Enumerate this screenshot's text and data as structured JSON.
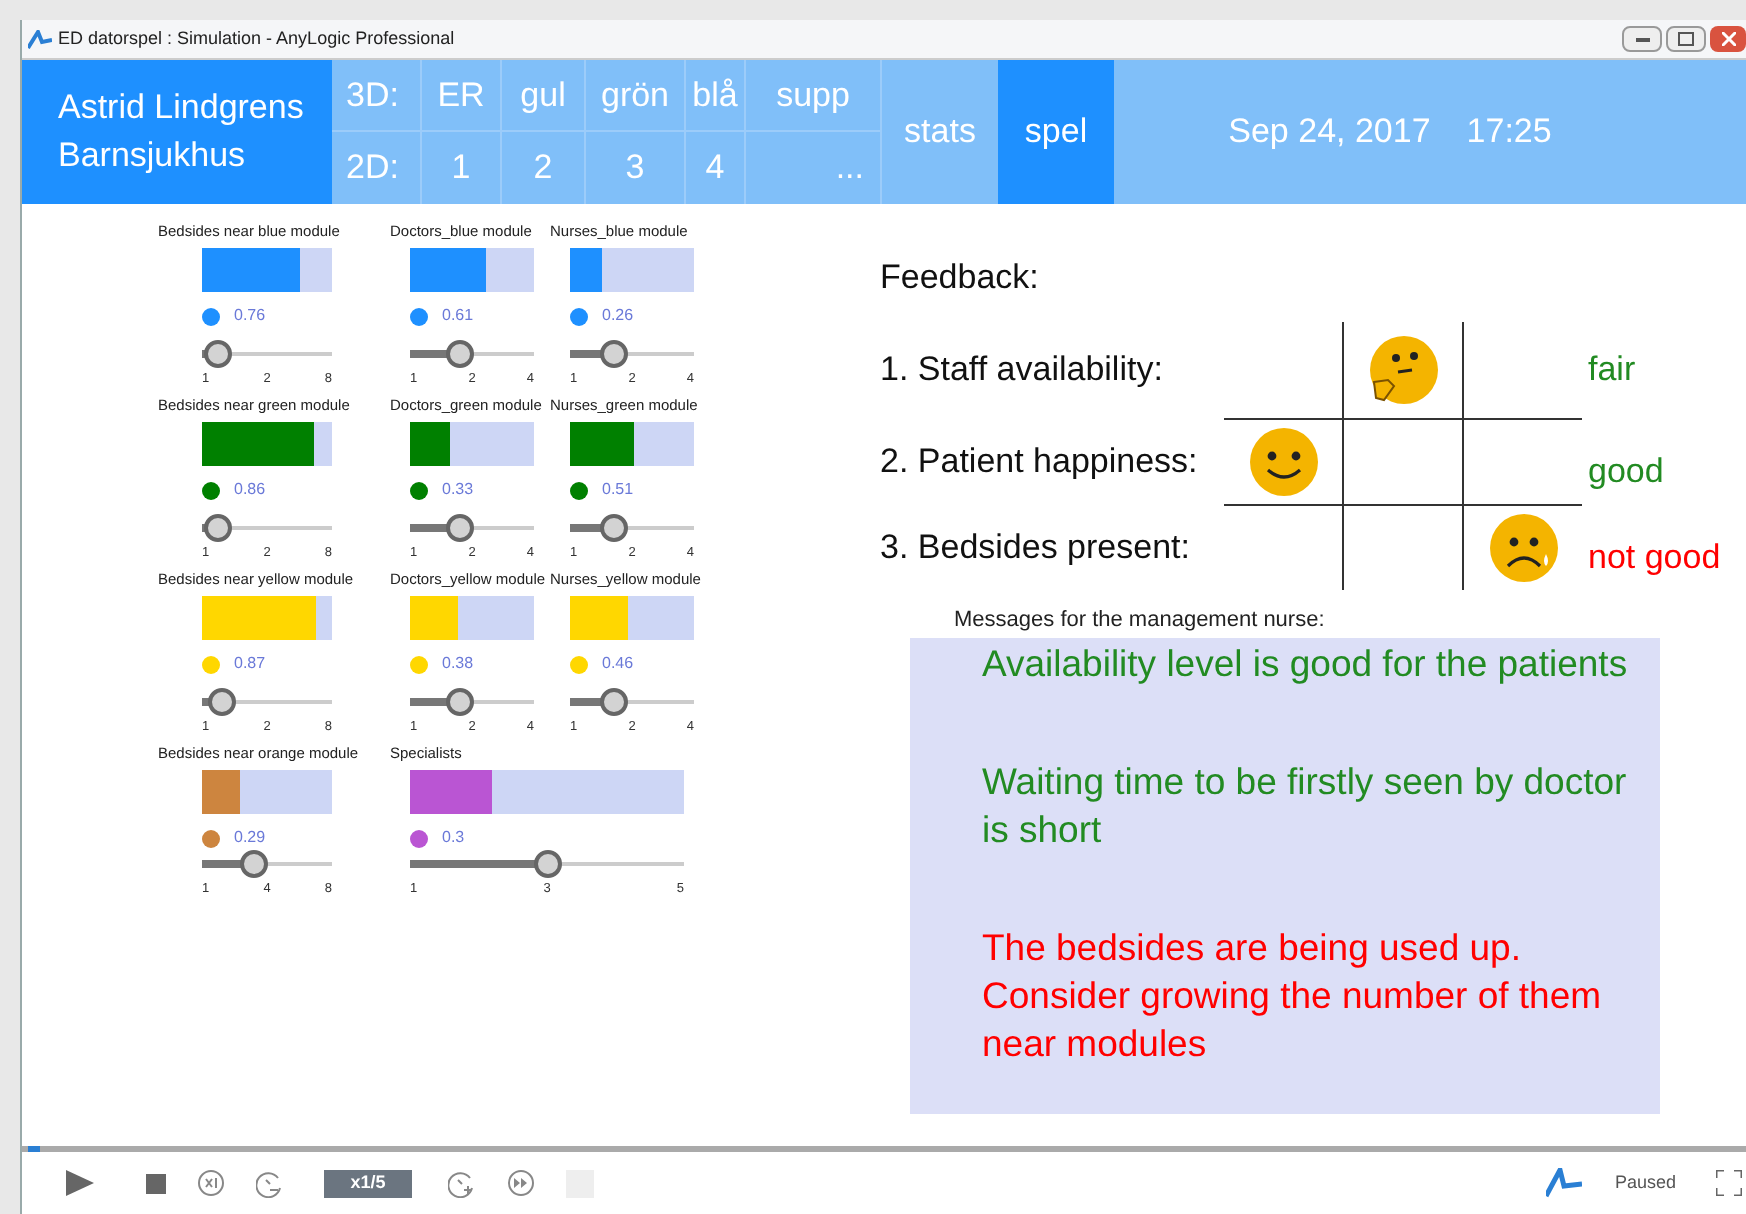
{
  "window": {
    "title": "ED datorspel : Simulation - AnyLogic Professional"
  },
  "header": {
    "brand_lines": [
      "Astrid Lindgrens",
      "Barnsjukhus"
    ],
    "rows": [
      [
        "3D:",
        "ER",
        "gul",
        "grön",
        "blå",
        "supp"
      ],
      [
        "2D:",
        "1",
        "2",
        "3",
        "4",
        "..."
      ]
    ],
    "tabs": [
      {
        "label": "stats",
        "selected": false
      },
      {
        "label": "spel",
        "selected": true
      }
    ],
    "date": "Sep 24, 2017",
    "time": "17:25"
  },
  "modules": [
    [
      {
        "title": "Bedsides near blue module",
        "color": "#1e90ff",
        "level": 0.76,
        "value": "0.76",
        "slider": {
          "level": 0.12,
          "ticks": [
            "1",
            "2",
            "8"
          ]
        }
      },
      {
        "title": "Doctors_blue module",
        "color": "#1e90ff",
        "level": 0.61,
        "value": "0.61",
        "slider": {
          "level": 0.4,
          "ticks": [
            "1",
            "2",
            "4"
          ]
        }
      },
      {
        "title": "Nurses_blue module",
        "color": "#1e90ff",
        "level": 0.26,
        "value": "0.26",
        "slider": {
          "level": 0.35,
          "ticks": [
            "1",
            "2",
            "4"
          ]
        }
      }
    ],
    [
      {
        "title": "Bedsides near green module",
        "color": "#008000",
        "level": 0.86,
        "value": "0.86",
        "slider": {
          "level": 0.12,
          "ticks": [
            "1",
            "2",
            "8"
          ]
        }
      },
      {
        "title": "Doctors_green module",
        "color": "#008000",
        "level": 0.33,
        "value": "0.33",
        "slider": {
          "level": 0.4,
          "ticks": [
            "1",
            "2",
            "4"
          ]
        }
      },
      {
        "title": "Nurses_green module",
        "color": "#008000",
        "level": 0.51,
        "value": "0.51",
        "slider": {
          "level": 0.35,
          "ticks": [
            "1",
            "2",
            "4"
          ]
        }
      }
    ],
    [
      {
        "title": "Bedsides near yellow module",
        "color": "#ffd700",
        "level": 0.87,
        "value": "0.87",
        "slider": {
          "level": 0.15,
          "ticks": [
            "1",
            "2",
            "8"
          ]
        }
      },
      {
        "title": "Doctors_yellow module",
        "color": "#ffd700",
        "level": 0.38,
        "value": "0.38",
        "slider": {
          "level": 0.4,
          "ticks": [
            "1",
            "2",
            "4"
          ]
        }
      },
      {
        "title": "Nurses_yellow module",
        "color": "#ffd700",
        "level": 0.46,
        "value": "0.46",
        "slider": {
          "level": 0.35,
          "ticks": [
            "1",
            "2",
            "4"
          ]
        }
      }
    ],
    [
      {
        "title": "Bedsides near orange module",
        "color": "#cd853f",
        "level": 0.29,
        "value": "0.29",
        "slider": {
          "level": 0.4,
          "ticks": [
            "1",
            "4",
            "8"
          ]
        }
      },
      {
        "title": "Specialists",
        "color": "#ba55d3",
        "level": 0.3,
        "value": "0.3",
        "slider": {
          "level": 0.5,
          "ticks": [
            "1",
            "3",
            "5"
          ]
        }
      }
    ]
  ],
  "feedback": {
    "title": "Feedback:",
    "items": [
      {
        "label": "1. Staff availability:",
        "kind": "thinking",
        "rating": "fair",
        "color": "#228b22"
      },
      {
        "label": "2. Patient happiness:",
        "kind": "smile",
        "rating": "good",
        "color": "#228b22"
      },
      {
        "label": "3. Bedsides present:",
        "kind": "sad",
        "rating": "not good",
        "color": "#ff0000"
      }
    ]
  },
  "messages": {
    "title": "Messages for the management nurse:",
    "items": [
      {
        "text": "Availability level is good for the patients",
        "color": "#228b22"
      },
      {
        "text": "Waiting time to be firstly seen by doctor is short",
        "color": "#228b22"
      },
      {
        "text": "The bedsides are being used up. Consider growing the number of them near modules",
        "color": "#ff0000"
      }
    ]
  },
  "toolbar": {
    "speed": "x1/5",
    "status": "Paused"
  }
}
